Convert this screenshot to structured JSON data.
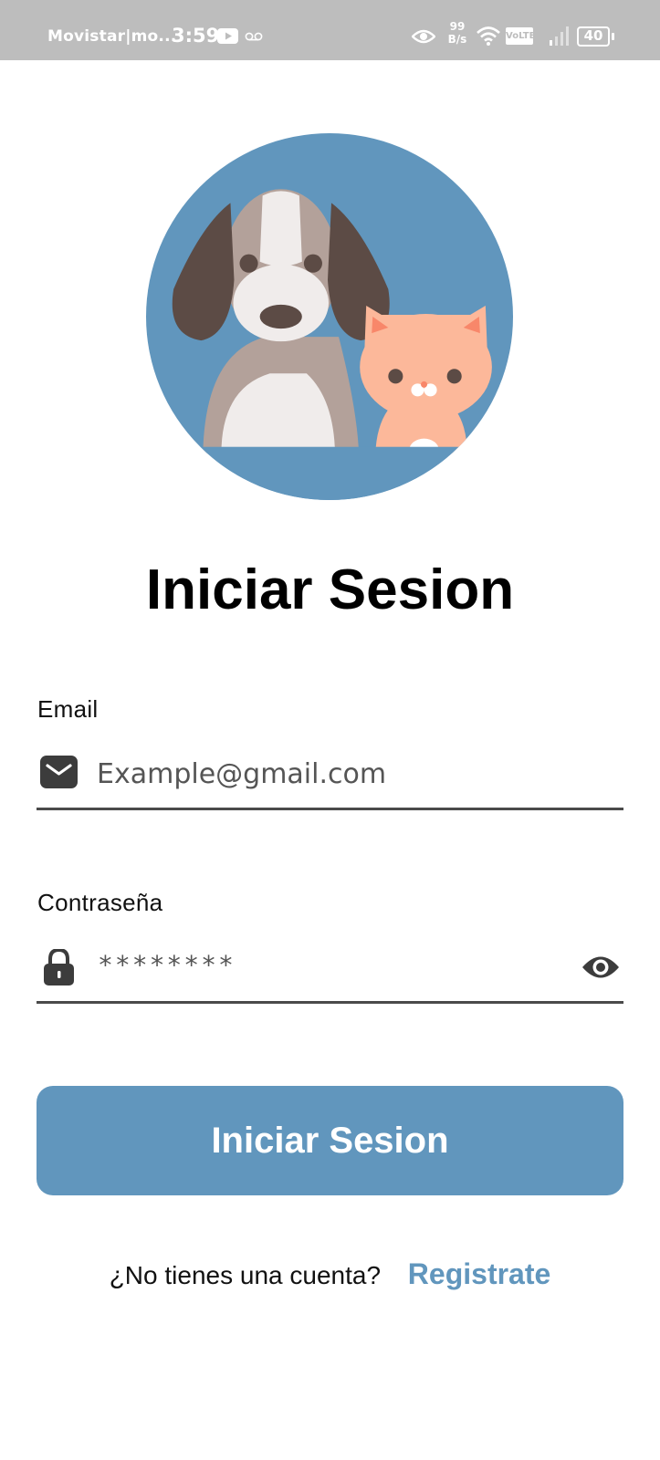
{
  "status_bar": {
    "carrier": "Movistar|mo...",
    "time": "3:59",
    "net_speed_value": "99",
    "net_speed_unit": "B/s",
    "volte": "VoLTE",
    "battery": "40"
  },
  "hero": {
    "illustration": "dog-and-cat",
    "circle_color": "#6196bd"
  },
  "title": "Iniciar Sesion",
  "email": {
    "label": "Email",
    "placeholder": "Example@gmail.com",
    "icon": "envelope-icon"
  },
  "password": {
    "label": "Contraseña",
    "masked_value": "********",
    "icon": "lock-icon",
    "toggle_icon": "eye-icon"
  },
  "login_button": {
    "label": "Iniciar Sesion",
    "color": "#6196bd"
  },
  "footer": {
    "question": "¿No tienes una cuenta?",
    "register_link": "Registrate"
  }
}
